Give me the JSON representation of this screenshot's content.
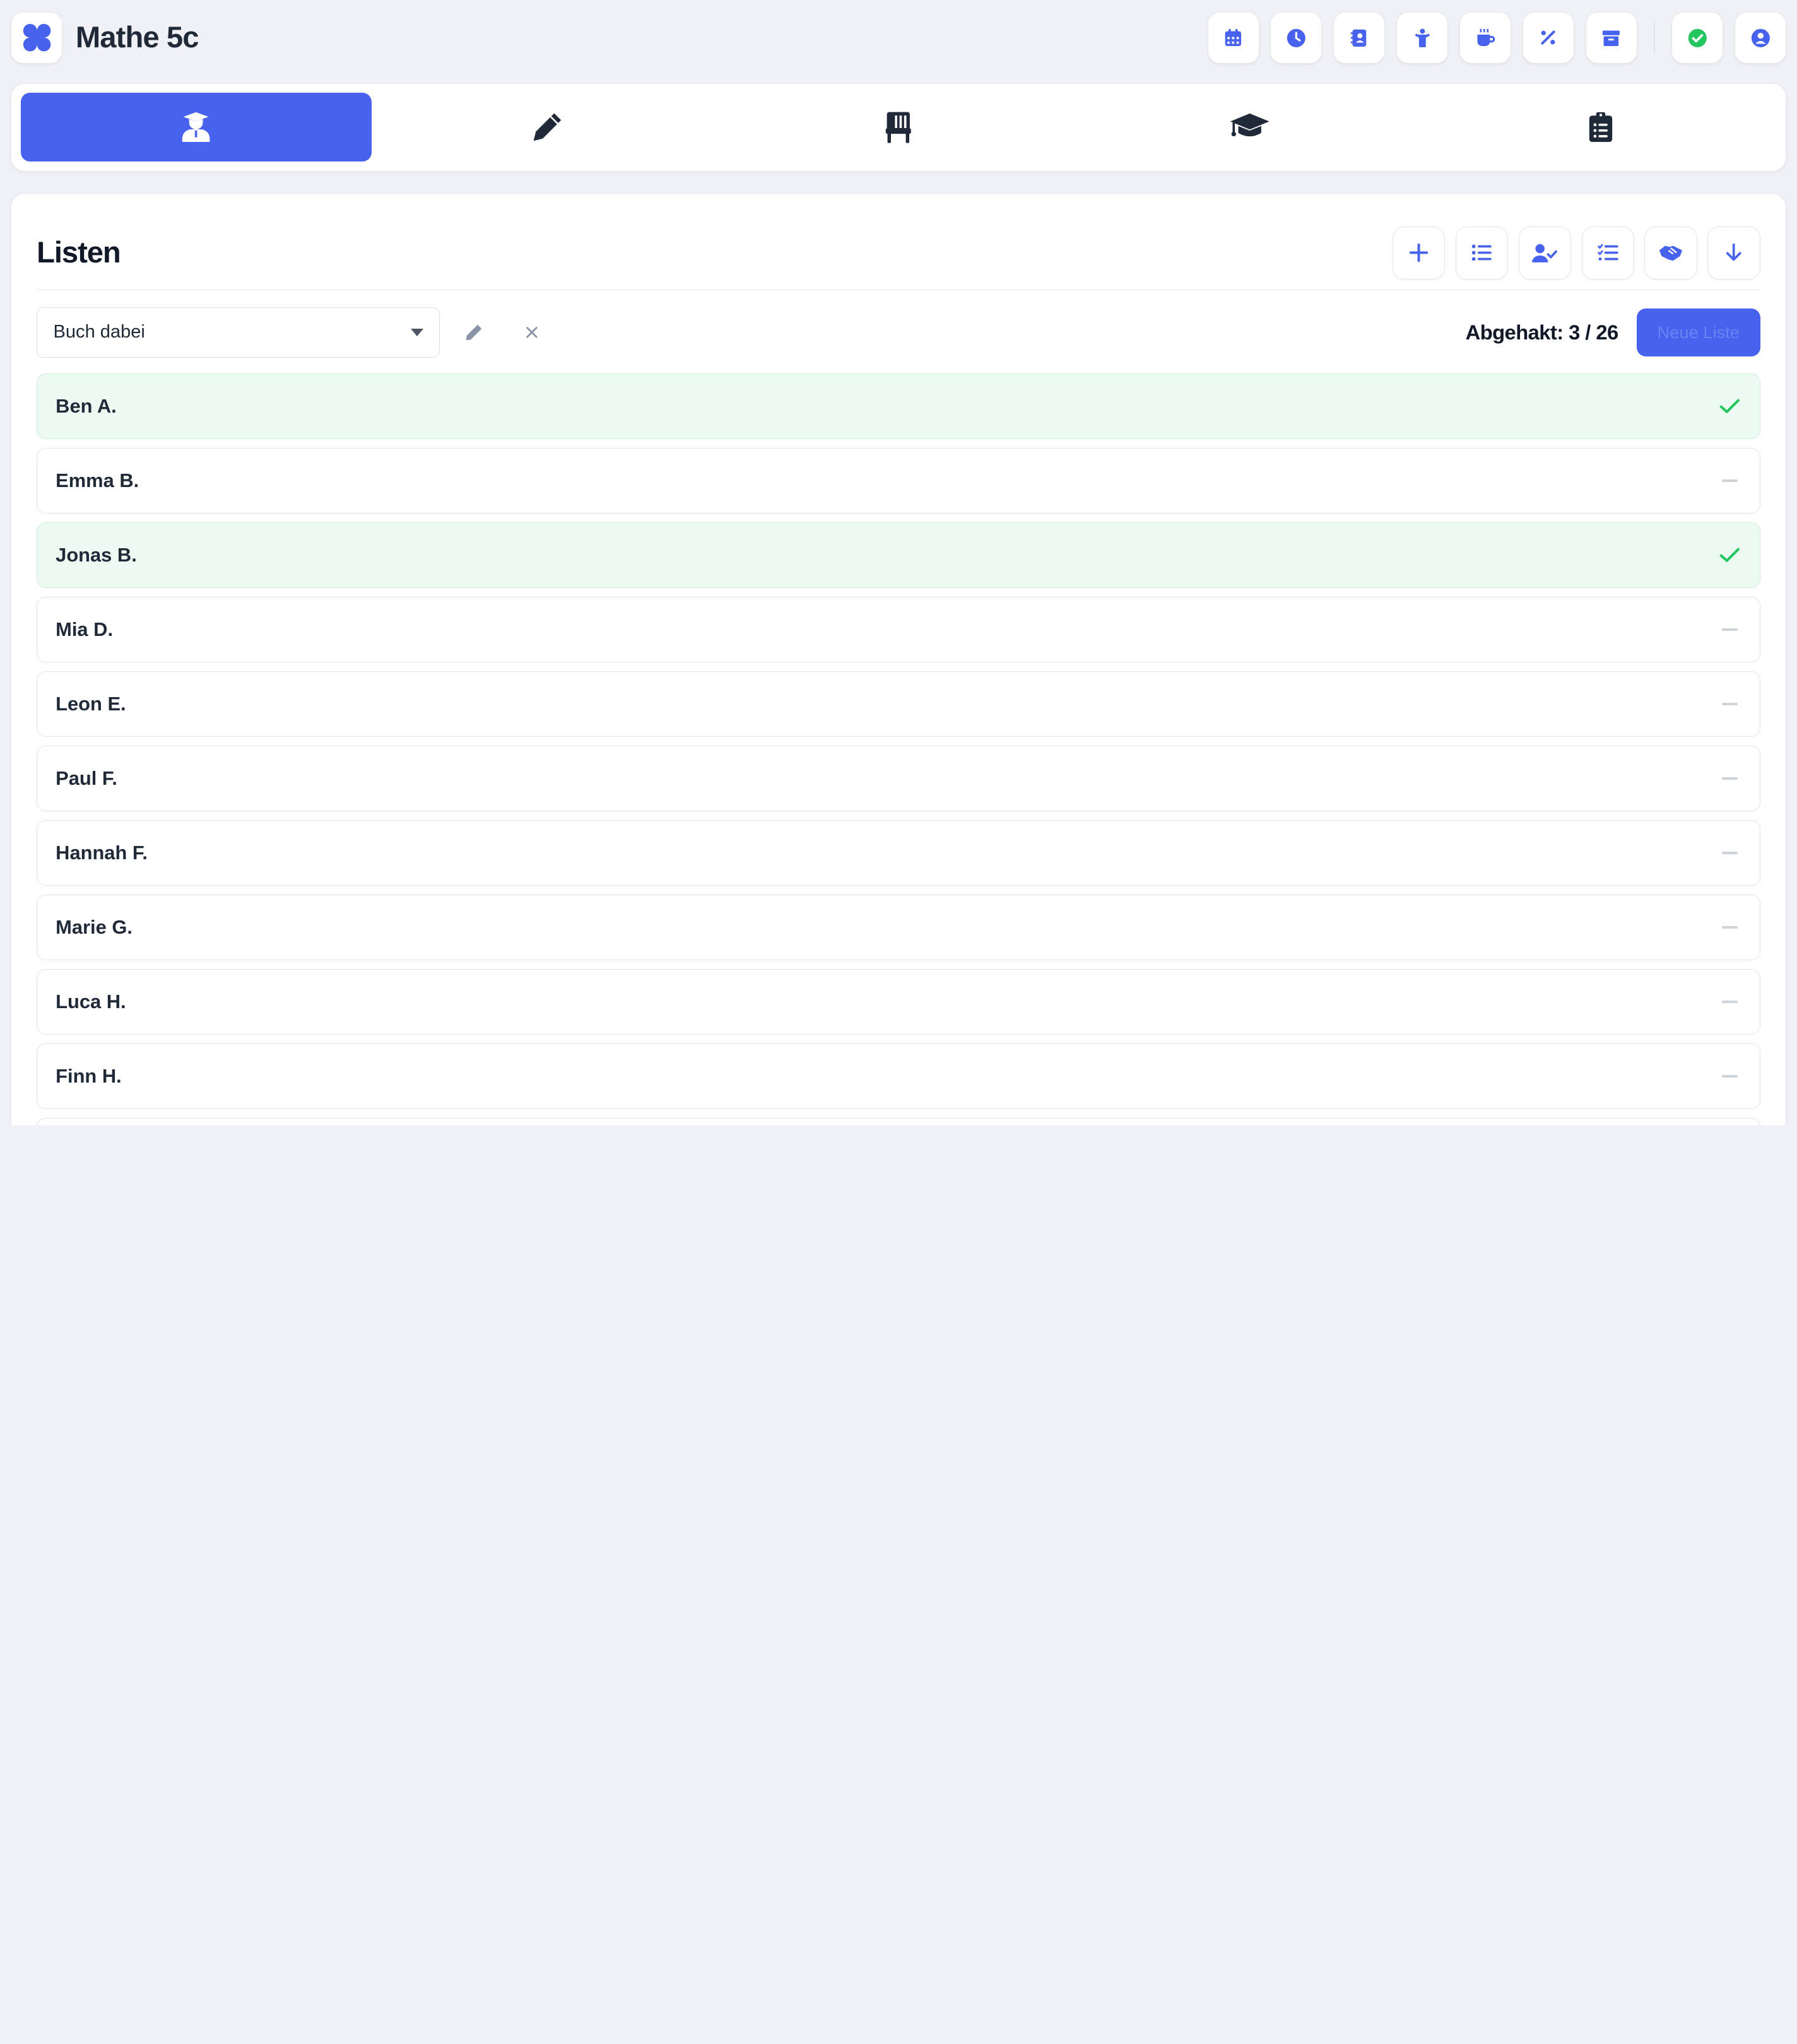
{
  "app": {
    "title": "Mathe 5c"
  },
  "header": {
    "icons": [
      "calendar-icon",
      "clock-icon",
      "contact-book-icon",
      "child-icon",
      "coffee-icon",
      "percent-icon",
      "archive-icon",
      "status-ok-icon",
      "user-account-icon"
    ]
  },
  "tabs": [
    {
      "id": "students",
      "icon": "student-teacher-icon",
      "active": true
    },
    {
      "id": "grades",
      "icon": "pencil-icon",
      "active": false
    },
    {
      "id": "seating",
      "icon": "chair-icon",
      "active": false
    },
    {
      "id": "exams",
      "icon": "graduation-cap-icon",
      "active": false
    },
    {
      "id": "tasks",
      "icon": "clipboard-list-icon",
      "active": false
    }
  ],
  "section": {
    "title": "Listen",
    "actions": [
      "add-icon",
      "list-icon",
      "user-check-icon",
      "checklist-icon",
      "handshake-icon",
      "arrow-down-icon"
    ]
  },
  "toolbar": {
    "selected_list": "Buch dabei",
    "checked_label": "Abgehakt: 3 / 26",
    "new_list_label": "Neue Liste"
  },
  "students": [
    {
      "name": "Ben A.",
      "checked": true
    },
    {
      "name": "Emma B.",
      "checked": false
    },
    {
      "name": "Jonas B.",
      "checked": true
    },
    {
      "name": "Mia D.",
      "checked": false
    },
    {
      "name": "Leon E.",
      "checked": false
    },
    {
      "name": "Paul F.",
      "checked": false
    },
    {
      "name": "Hannah F.",
      "checked": false
    },
    {
      "name": "Marie G.",
      "checked": false
    },
    {
      "name": "Luca H.",
      "checked": false
    },
    {
      "name": "Finn H.",
      "checked": false
    },
    {
      "name": "",
      "checked": false
    }
  ],
  "colors": {
    "accent": "#4763ee",
    "check": "#22c55e",
    "checked_row_bg": "#edfaf2"
  }
}
